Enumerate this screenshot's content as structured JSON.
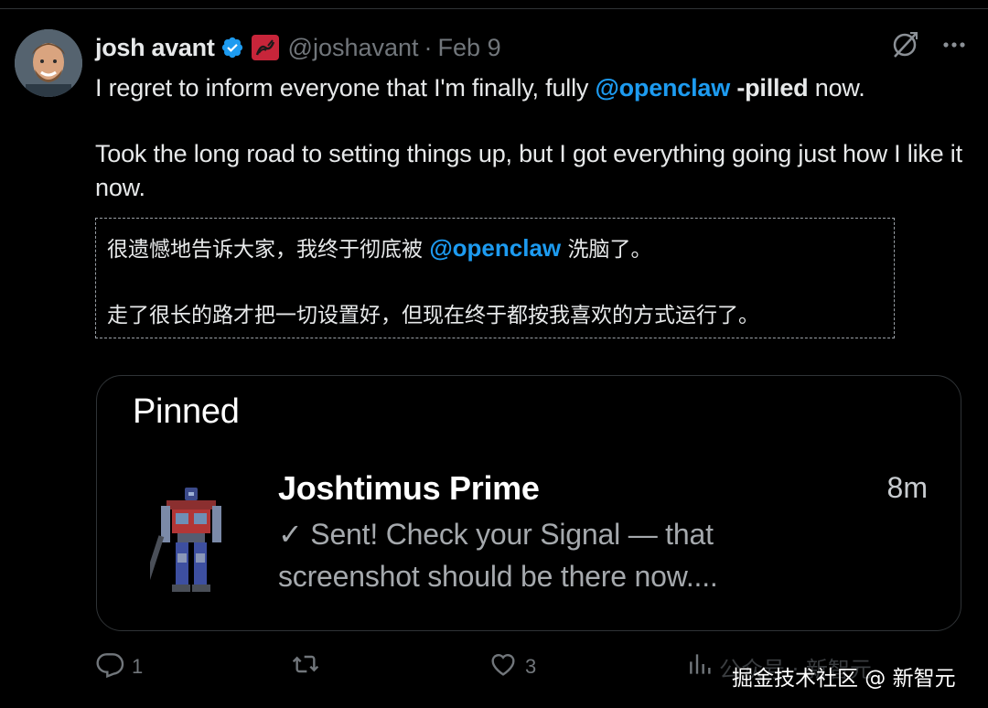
{
  "post": {
    "author": {
      "name": "josh avant",
      "handle": "@joshavant",
      "separator": "·",
      "date": "Feb 9"
    },
    "body": {
      "line1_prefix": "I regret to inform everyone that I'm finally, fully ",
      "line1_mention": "@openclaw",
      "line1_bold": " -pilled",
      "line1_suffix": " now.",
      "paragraph2": "Took the long road to setting things up, but I got everything going just how I like it now."
    },
    "translation": {
      "line1_prefix": "很遗憾地告诉大家，我终于彻底被 ",
      "line1_mention": "@openclaw",
      "line1_suffix": " 洗脑了。",
      "paragraph2": "走了很长的路才把一切设置好，但现在终于都按我喜欢的方式运行了。"
    },
    "attached_image": {
      "section_title": "Pinned",
      "chat": {
        "name": "Joshtimus Prime",
        "time": "8m",
        "preview": "✓ Sent! Check your Signal — that screenshot should be there now...."
      }
    },
    "actions": {
      "reply_count": "1",
      "repost_count": "",
      "like_count": "3"
    }
  },
  "watermark": {
    "text": "掘金技术社区 @ 新智元",
    "ghost_text": "公众号 · 新智元"
  },
  "colors": {
    "background": "#000000",
    "text": "#e7e9ea",
    "muted": "#71767b",
    "link": "#1d9bf0",
    "verified": "#1d9bf0",
    "border": "#2f3336"
  },
  "icons": {
    "verified": "verified-badge-icon",
    "flag": "red-flag-emoji-icon",
    "grok": "grok-icon",
    "more": "more-dots-icon",
    "reply": "reply-icon",
    "repost": "repost-icon",
    "like": "heart-icon",
    "views": "views-icon"
  }
}
